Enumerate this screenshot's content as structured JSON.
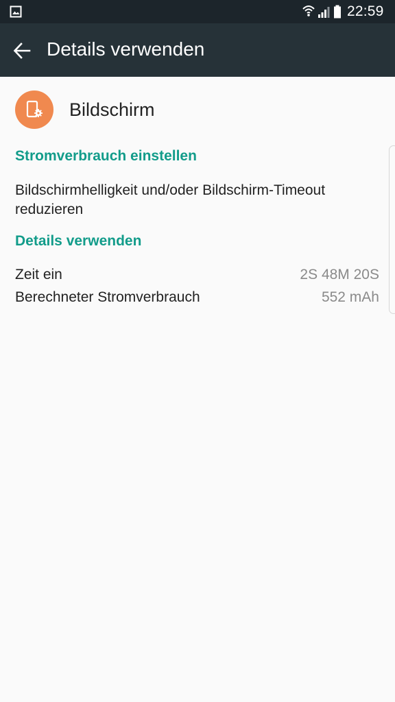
{
  "status_bar": {
    "time": "22:59",
    "icons": [
      "gallery-icon",
      "wifi-icon",
      "signal-icon",
      "battery-icon"
    ]
  },
  "app_bar": {
    "title": "Details verwenden",
    "back_icon": "arrow-left-icon"
  },
  "app": {
    "name": "Bildschirm",
    "icon": "screen-settings-icon",
    "icon_color": "#f0894f"
  },
  "power_section": {
    "title": "Stromverbrauch einstellen",
    "tip": "Bildschirmhelligkeit und/oder Bildschirm-Timeout reduzieren"
  },
  "details_section": {
    "title": "Details verwenden",
    "rows": [
      {
        "label": "Zeit ein",
        "value": "2S 48M 20S"
      },
      {
        "label": "Berechneter Stromverbrauch",
        "value": "552 mAh"
      }
    ]
  },
  "colors": {
    "accent": "#129c8a",
    "app_bar": "#263238",
    "status_bar": "#1c252b",
    "background": "#fafafa"
  }
}
